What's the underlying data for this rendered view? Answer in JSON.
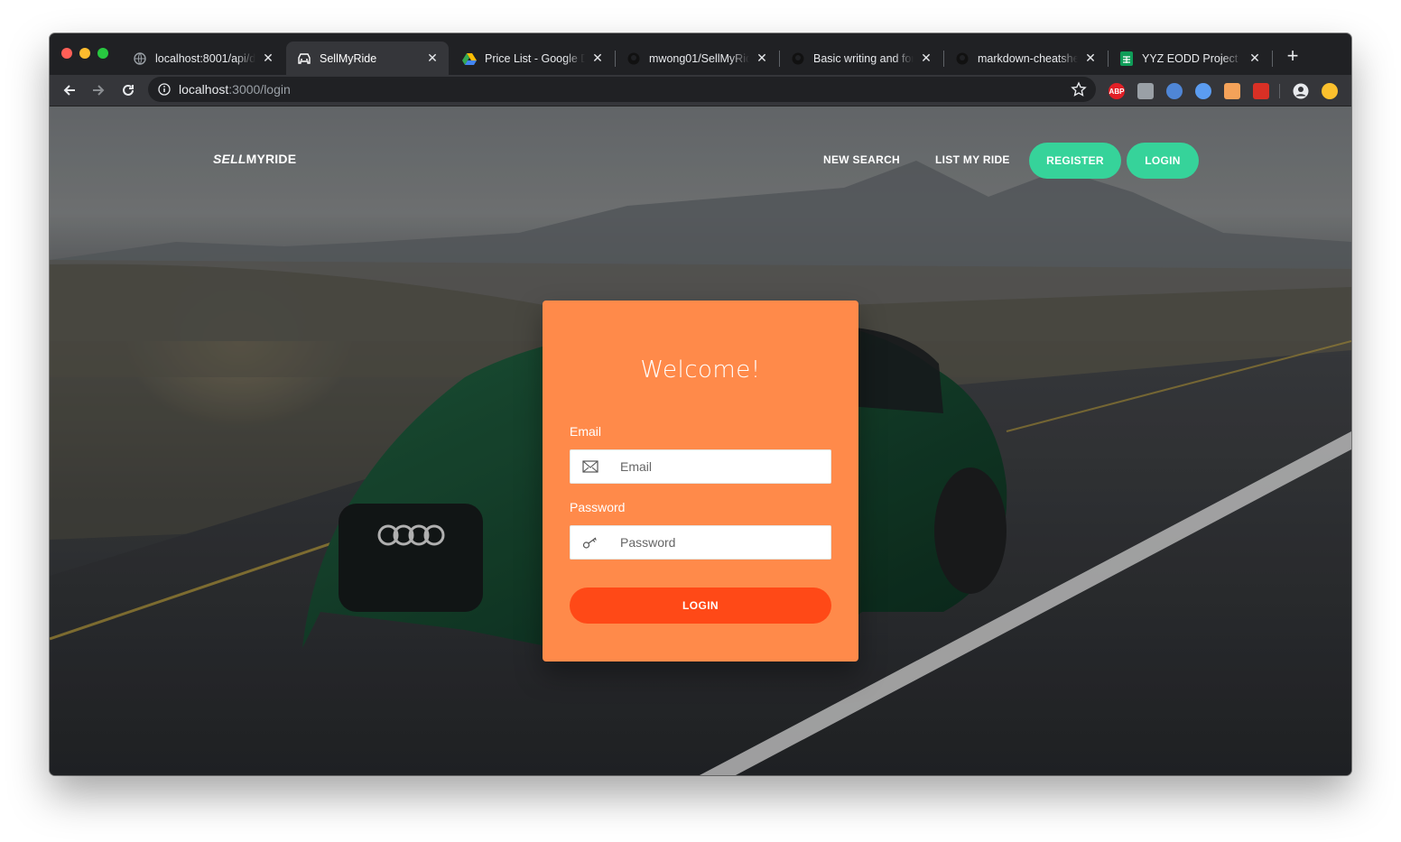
{
  "browser": {
    "tabs": [
      {
        "title": "localhost:8001/api/del",
        "active": false,
        "favicon": "globe-icon"
      },
      {
        "title": "SellMyRide",
        "active": true,
        "favicon": "car-icon"
      },
      {
        "title": "Price List - Google Dri",
        "active": false,
        "favicon": "google-drive-icon"
      },
      {
        "title": "mwong01/SellMyRide",
        "active": false,
        "favicon": "github-icon"
      },
      {
        "title": "Basic writing and form",
        "active": false,
        "favicon": "github-icon"
      },
      {
        "title": "markdown-cheatshee",
        "active": false,
        "favicon": "github-icon"
      },
      {
        "title": "YYZ EODD Project Lis",
        "active": false,
        "favicon": "google-sheets-icon"
      }
    ],
    "close_glyph": "✕",
    "new_tab_glyph": "+",
    "url_host": "localhost",
    "url_rest": ":3000/login",
    "extensions": [
      {
        "name": "adblock-icon",
        "text": "ABP",
        "color": "#e21f26"
      },
      {
        "name": "extension-icon",
        "text": "",
        "color": "#9aa0a6"
      },
      {
        "name": "extension-icon",
        "text": "",
        "color": "#4f86d6"
      },
      {
        "name": "extension-icon",
        "text": "",
        "color": "#5b9cf0"
      },
      {
        "name": "extension-icon",
        "text": "",
        "color": "#f4a259"
      },
      {
        "name": "extension-icon",
        "text": "",
        "color": "#d93025"
      }
    ]
  },
  "site": {
    "brand_italic": "SELL",
    "brand_rest": "MYRIDE",
    "nav": {
      "new_search": "NEW SEARCH",
      "list_my_ride": "LIST MY RIDE",
      "register": "REGISTER",
      "login": "LOGIN"
    },
    "accent": "#36d39a"
  },
  "login_card": {
    "heading": "Welcome!",
    "email_label": "Email",
    "email_placeholder": "Email",
    "password_label": "Password",
    "password_placeholder": "Password",
    "submit": "LOGIN",
    "card_color": "#ff8a4a",
    "button_color": "#ff4917"
  }
}
